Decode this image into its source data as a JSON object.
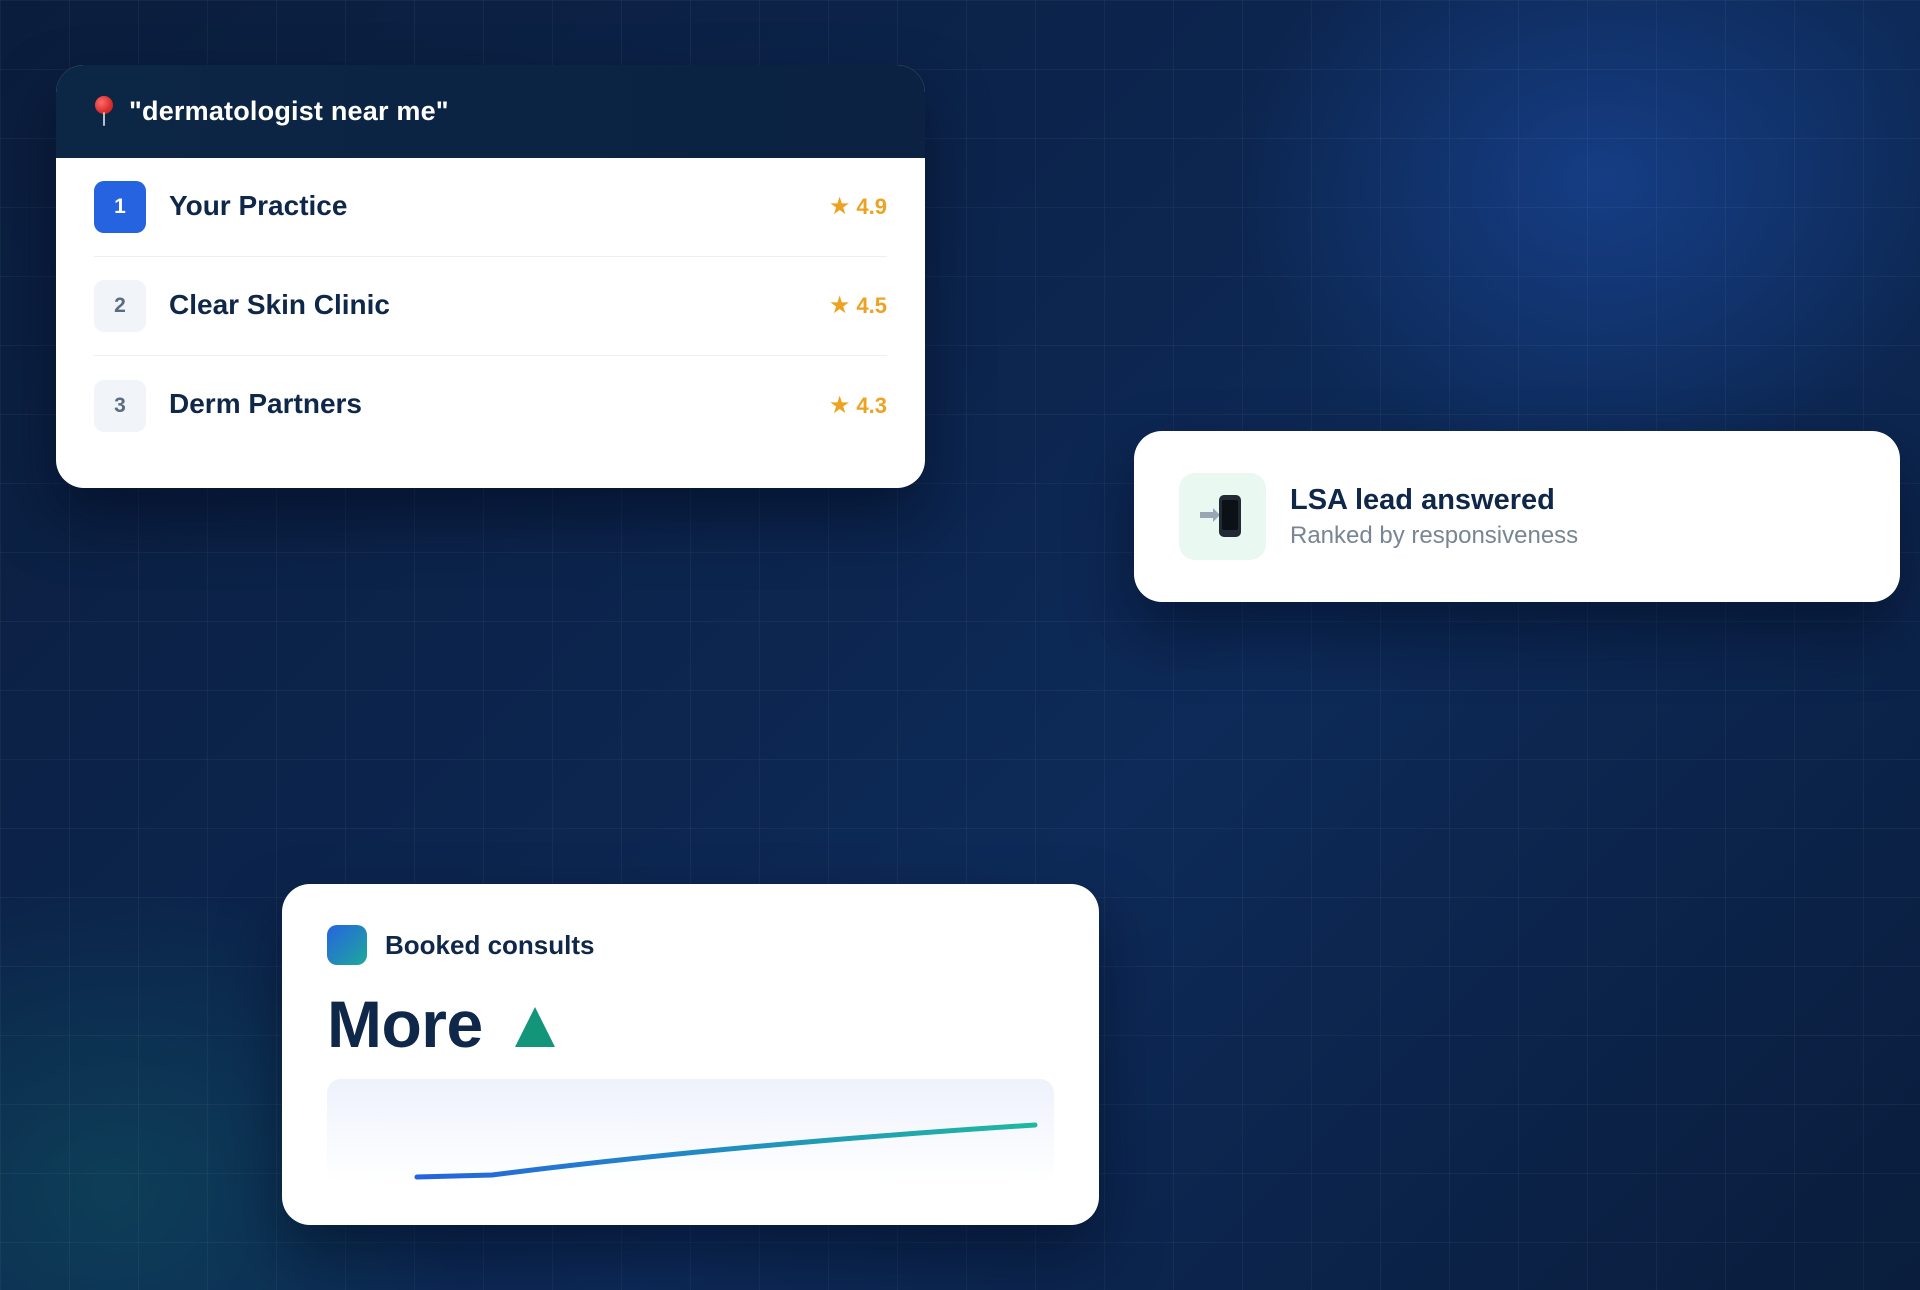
{
  "search": {
    "icon": "map-pin-icon",
    "query": "\"dermatologist near me\"",
    "results": [
      {
        "rank": "1",
        "name": "Your Practice",
        "rating": "4.9",
        "highlighted": true
      },
      {
        "rank": "2",
        "name": "Clear Skin Clinic",
        "rating": "4.5",
        "highlighted": false
      },
      {
        "rank": "3",
        "name": "Derm Partners",
        "rating": "4.3",
        "highlighted": false
      }
    ],
    "star_glyph": "★"
  },
  "lsa": {
    "icon": "mobile-phone-incoming-icon",
    "title": "LSA lead answered",
    "subtitle": "Ranked by responsiveness"
  },
  "consults": {
    "label": "Booked consults",
    "value": "More",
    "trend": "up",
    "trend_icon": "trend-up-icon"
  },
  "colors": {
    "primary_blue": "#2563e0",
    "navy_text": "#0f2748",
    "star_gold": "#eda321",
    "trend_green": "#13957a",
    "teal": "#1fa99a"
  }
}
